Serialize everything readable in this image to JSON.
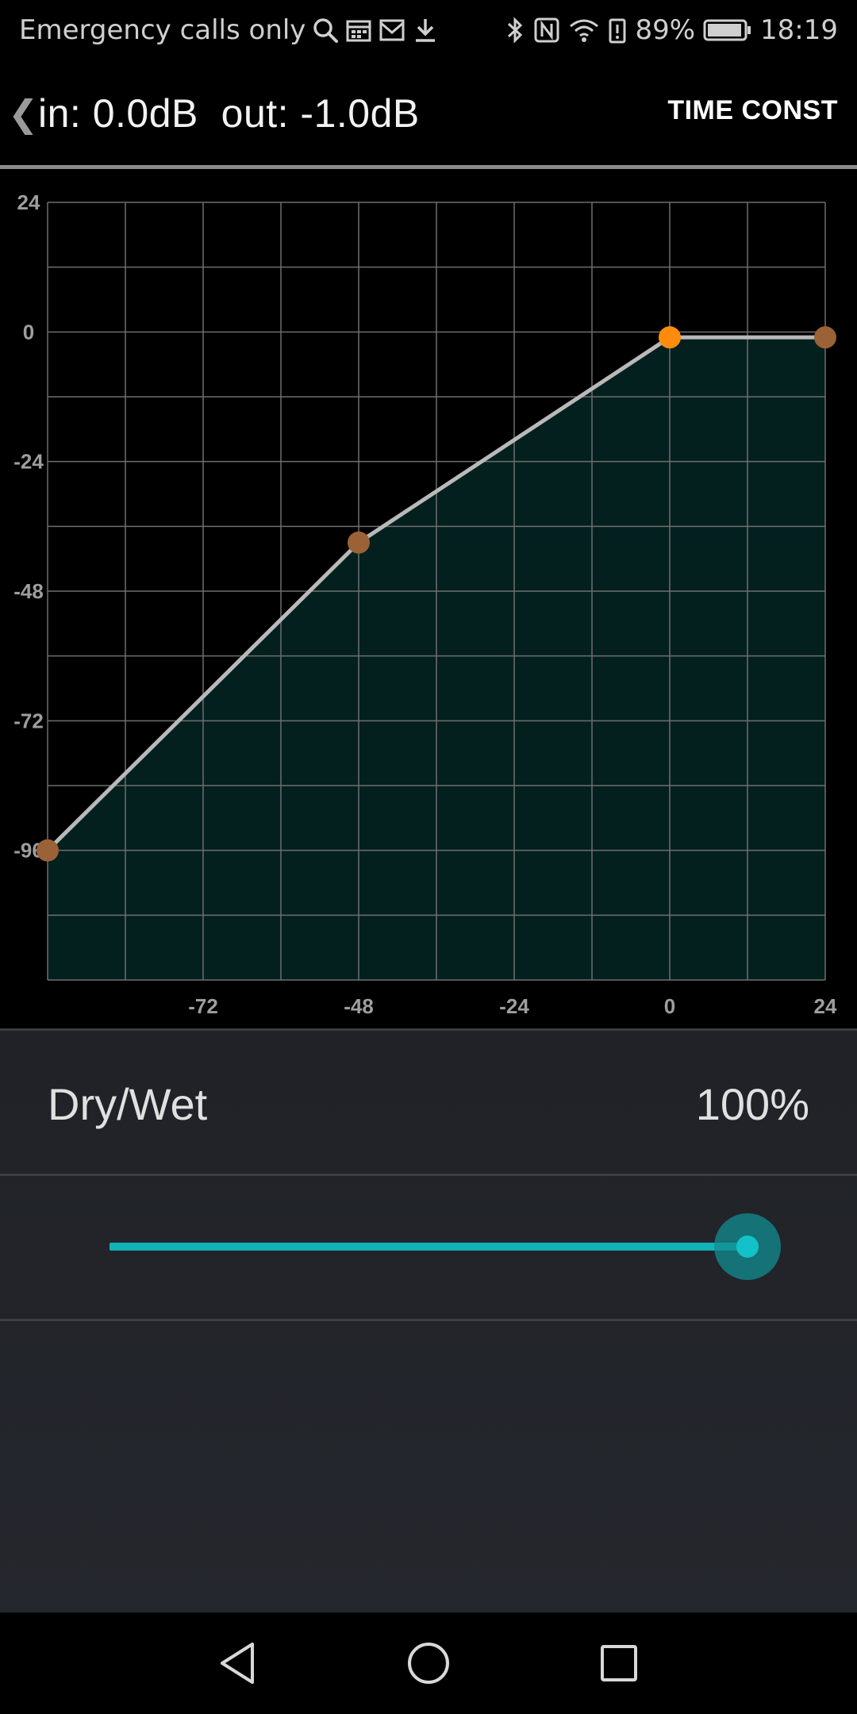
{
  "status_bar": {
    "carrier_text": "Emergency calls only",
    "left_icons": [
      "search-icon",
      "calendar-icon",
      "mail-icon",
      "download-icon"
    ],
    "right_icons": [
      "bluetooth-icon",
      "nfc-icon",
      "wifi-icon",
      "battery-saver-icon"
    ],
    "battery_percent": "89%",
    "time": "18:19"
  },
  "app_bar": {
    "io_readout": "in: 0.0dB  out: -1.0dB",
    "time_const_label": "TIME CONST"
  },
  "chart_data": {
    "type": "area",
    "title": "",
    "xlabel": "",
    "ylabel": "",
    "xlim": [
      -96,
      24
    ],
    "ylim": [
      -120,
      24
    ],
    "x_ticks": [
      -72,
      -48,
      -24,
      0,
      24
    ],
    "y_ticks": [
      24,
      0,
      -24,
      -48,
      -72,
      -96
    ],
    "grid_x": [
      -96,
      -84,
      -72,
      -60,
      -48,
      -36,
      -24,
      -12,
      0,
      12,
      24
    ],
    "grid_y": [
      24,
      12,
      0,
      -12,
      -24,
      -36,
      -48,
      -60,
      -72,
      -84,
      -96,
      -108,
      -120
    ],
    "grid": true,
    "series": [
      {
        "x": [
          -96,
          -48,
          0,
          24
        ],
        "y": [
          -96,
          -39,
          -1,
          -1
        ]
      }
    ],
    "point_colors": [
      "#9a6236",
      "#9a6236",
      "#ff8c0d",
      "#9a6236"
    ],
    "line_color": "#b9b9b9",
    "fill_color": "#03201f"
  },
  "panel": {
    "drywet_label": "Dry/Wet",
    "drywet_value": "100%",
    "slider_level": 1.0,
    "accent_color": "#12b3b8"
  },
  "nav_bar": {
    "icons": [
      "back-triangle-icon",
      "home-circle-icon",
      "recents-square-icon"
    ]
  }
}
